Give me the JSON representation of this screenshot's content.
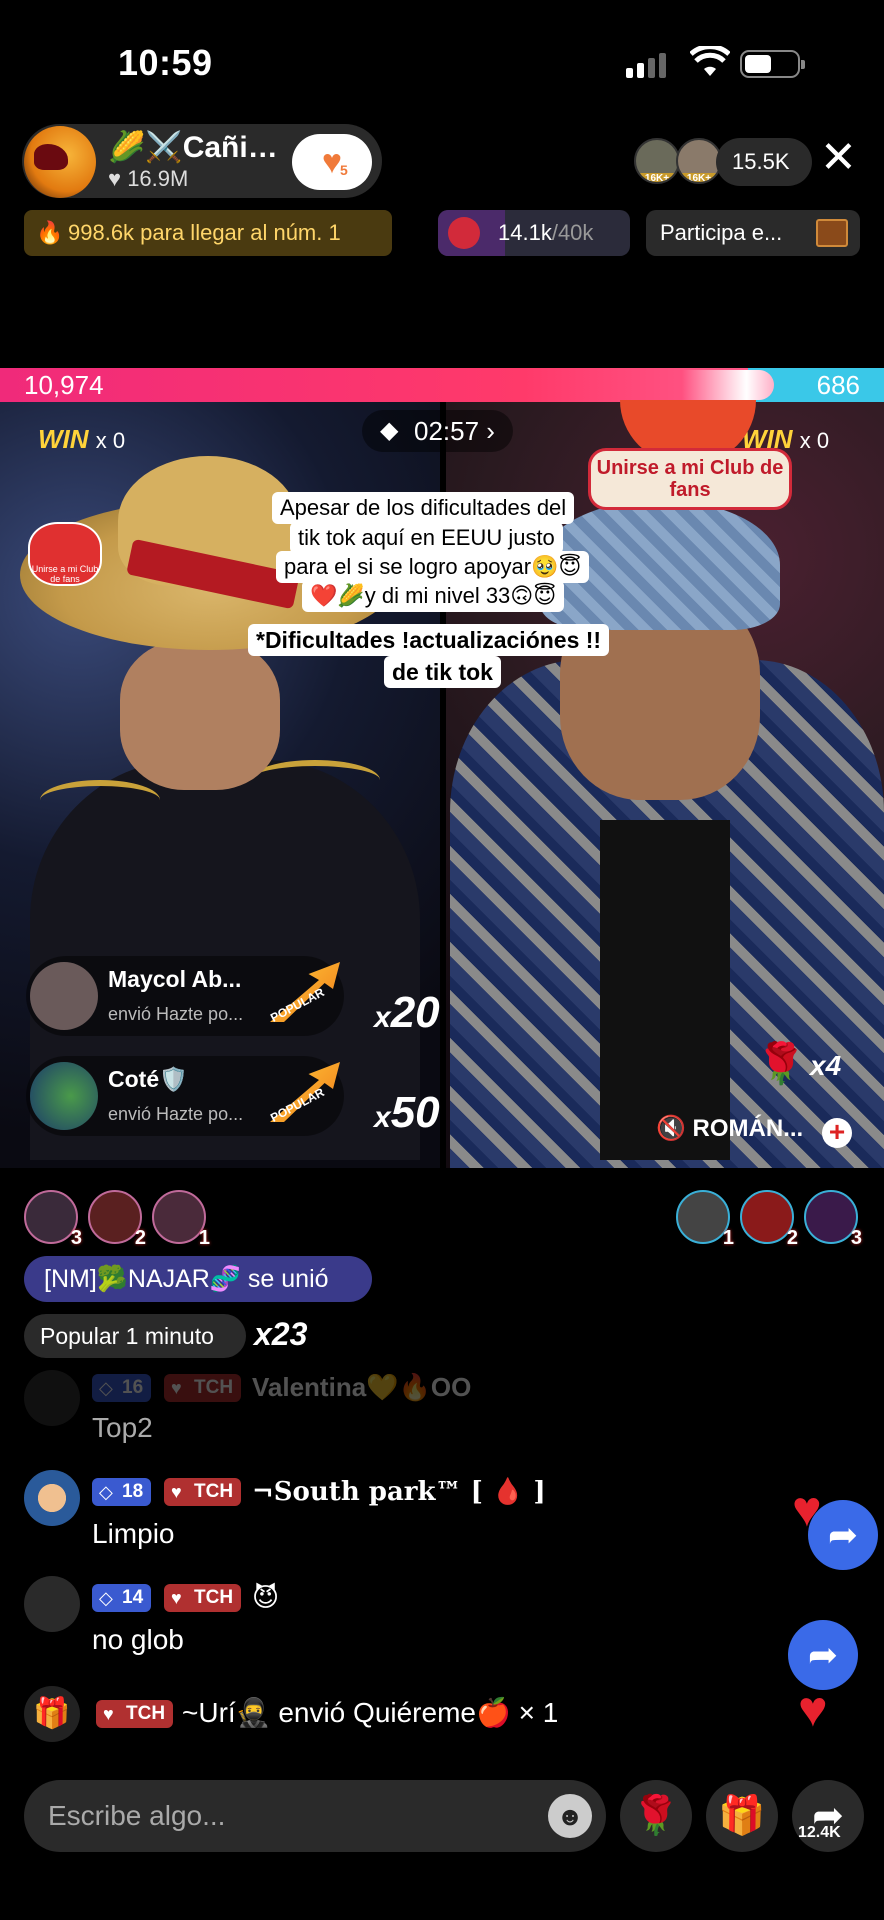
{
  "status_bar": {
    "time": "10:59"
  },
  "host": {
    "name": "🌽⚔️Cañi…",
    "likes": "16.9M",
    "follow_count": "5"
  },
  "viewers": {
    "badges": [
      "16K+",
      "16K+"
    ],
    "count": "15.5K"
  },
  "rank_goal": "998.6k para llegar al núm. 1",
  "gift_goal": {
    "current": "14.1k",
    "target": "/40k",
    "progress": 0.35
  },
  "participate": "Participa e...",
  "battle": {
    "left_score": "10,974",
    "right_score": "686",
    "timer": "02:57",
    "left_win": "WIN",
    "left_win_count": "x 0",
    "right_win": "WIN",
    "right_win_count": "x 0"
  },
  "fan_club": {
    "label": "Unirse a mi Club de fans",
    "mini": "Unirse a mi Club de fans"
  },
  "caption": {
    "lines": [
      "Apesar  de los dificultades del",
      "tik tok aquí en EEUU justo",
      "para el si se logro apoyar🥹😇",
      "❤️🌽y di mi nivel 33🙃😇"
    ],
    "bold_lines": [
      "*Dificultades !actualizaciónes !!",
      "de tik tok"
    ]
  },
  "gift_notifications": [
    {
      "name": "Maycol Ab...",
      "sub": "envió Hazte po...",
      "gift": "POPULAR",
      "mult_x": "x",
      "mult": "20"
    },
    {
      "name": "Coté🛡️",
      "sub": "envió Hazte po...",
      "gift": "POPULAR",
      "mult_x": "x",
      "mult": "50"
    }
  ],
  "rose_gift": {
    "icon": "🌹",
    "count": "x4"
  },
  "music": "🔇 ROMÁN...",
  "top_gifters_left": [
    "3",
    "2",
    "1"
  ],
  "top_gifters_right": [
    "1",
    "2",
    "3"
  ],
  "joined_text": "[NM]🥦NAJAR🧬 se unió",
  "popular_chip": {
    "label": "Popular",
    "value": "1 minuto",
    "mult": "x23"
  },
  "comments": [
    {
      "level": "16",
      "tag": "TCH",
      "name": "Valentina💛🔥OO",
      "text": "Top2",
      "faded": true
    },
    {
      "level": "18",
      "tag": "TCH",
      "name": "¬South park™ [ 🩸 ]",
      "text": "Limpio"
    },
    {
      "level": "14",
      "tag": "TCH",
      "name": "😈",
      "text": "no glob"
    }
  ],
  "gift_line": {
    "tag": "TCH",
    "text": "~Urí🥷 envió Quiéreme🍎 × 1"
  },
  "input": {
    "placeholder": "Escribe algo..."
  },
  "bottom": {
    "share_count": "12.4K"
  },
  "icons": {
    "gift": "gift-icon",
    "share": "share-icon",
    "emoji": "emoji-icon",
    "rose": "rose-icon",
    "close": "close-icon",
    "heart": "heart-icon"
  }
}
